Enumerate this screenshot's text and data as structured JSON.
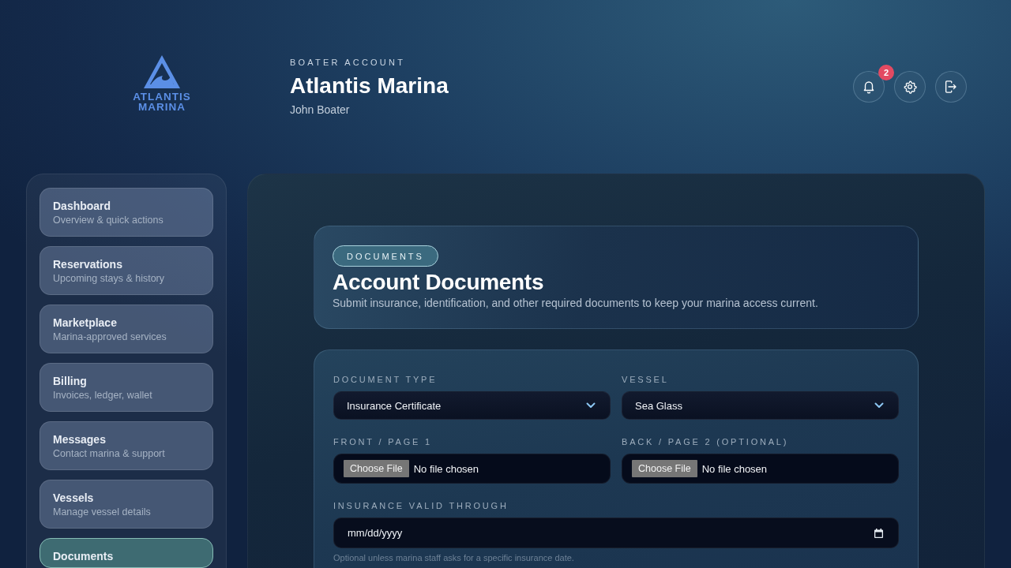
{
  "brand": {
    "name_lines": [
      "ATLANTIS",
      "MARINA"
    ]
  },
  "header": {
    "eyebrow": "BOATER ACCOUNT",
    "title": "Atlantis Marina",
    "user": "John Boater",
    "actions": [
      {
        "kind": "notifications",
        "badge": "2"
      },
      {
        "kind": "settings"
      },
      {
        "kind": "logout"
      }
    ]
  },
  "sidebar": {
    "items": [
      {
        "title": "Dashboard",
        "subtitle": "Overview & quick actions",
        "selected": false
      },
      {
        "title": "Reservations",
        "subtitle": "Upcoming stays & history",
        "selected": false
      },
      {
        "title": "Marketplace",
        "subtitle": "Marina-approved services",
        "selected": false
      },
      {
        "title": "Billing",
        "subtitle": "Invoices, ledger, wallet",
        "selected": false
      },
      {
        "title": "Messages",
        "subtitle": "Contact marina & support",
        "selected": false
      },
      {
        "title": "Vessels",
        "subtitle": "Manage vessel details",
        "selected": false
      },
      {
        "title": "Documents",
        "selected": true
      }
    ]
  },
  "page_header": {
    "tag": "DOCUMENTS",
    "title": "Account Documents",
    "description": "Submit insurance, identification, and other required documents to keep your marina access current."
  },
  "form": {
    "rows": [
      [
        {
          "kind": "select",
          "label": "DOCUMENT TYPE",
          "value": "Insurance Certificate"
        },
        {
          "kind": "select",
          "label": "VESSEL",
          "value": "Sea Glass"
        }
      ],
      [
        {
          "kind": "file",
          "label": "FRONT / PAGE 1",
          "button": "Choose File",
          "status": "No file chosen"
        },
        {
          "kind": "file",
          "label": "BACK / PAGE 2 (OPTIONAL)",
          "button": "Choose File",
          "status": "No file chosen"
        }
      ],
      [
        {
          "kind": "date",
          "label": "INSURANCE VALID THROUGH",
          "placeholder": "mm/dd/yyyy",
          "hint": "Optional unless marina staff asks for a specific insurance date."
        }
      ]
    ]
  }
}
